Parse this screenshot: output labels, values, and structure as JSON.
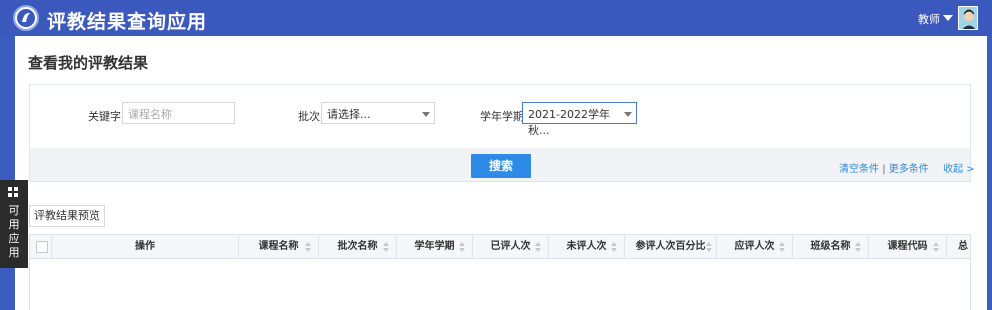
{
  "header": {
    "app_title": "评教结果查询应用",
    "user_role": "教师",
    "colors": {
      "header_bg": "#3b58bd",
      "accent": "#2d8ae6"
    }
  },
  "page": {
    "title": "查看我的评教结果"
  },
  "filters": {
    "keyword_label": "关键字",
    "keyword_placeholder": "课程名称",
    "batch_label": "批次",
    "batch_value": "请选择...",
    "term_label": "学年学期",
    "term_value": "2021-2022学年 秋..."
  },
  "actions": {
    "search_label": "搜索",
    "clear_label": "清空条件",
    "separator": "|",
    "more_label": "更多条件",
    "collapse_label": "收起 >"
  },
  "preview_tab": "评教结果预览",
  "table": {
    "columns": [
      "操作",
      "课程名称",
      "批次名称",
      "学年学期",
      "已评人次",
      "未评人次",
      "参评人次百分比",
      "应评人次",
      "班级名称",
      "课程代码",
      "总"
    ]
  },
  "side_dock": {
    "label": "可用应用"
  },
  "icons": [
    "logo-icon",
    "caret-down-icon",
    "avatar-icon",
    "select-caret-icon",
    "sort-icon",
    "grid-icon"
  ]
}
